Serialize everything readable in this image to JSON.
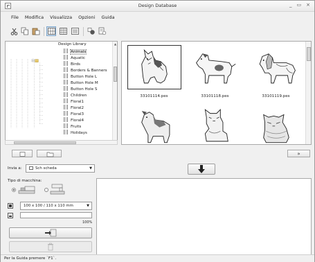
{
  "window": {
    "title": "Design Database",
    "controls": [
      "_",
      "▭",
      "×"
    ]
  },
  "menu": [
    "File",
    "Modifica",
    "Visualizza",
    "Opzioni",
    "Guida"
  ],
  "toolbar": {
    "icons": [
      "cut-icon",
      "copy-icon",
      "paste-icon",
      "large-thumbnails-icon",
      "medium-thumbnails-icon",
      "details-view-icon",
      "record-icon",
      "properties-icon"
    ]
  },
  "tree": {
    "root": "Design Library",
    "items": [
      "Animals",
      "Aquatic",
      "Birds",
      "Borders & Banners",
      "Button Hole L",
      "Button Hole M",
      "Button Hole S",
      "Children",
      "Floral1",
      "Floral2",
      "Floral3",
      "Floral4",
      "Fruits",
      "Holidays"
    ],
    "selected": "Animals"
  },
  "files": [
    {
      "name": "33101114.pes",
      "selected": true,
      "subject": "husky-puppy"
    },
    {
      "name": "33101118.pes",
      "selected": false,
      "subject": "spotted-dog"
    },
    {
      "name": "33101119.pes",
      "selected": false,
      "subject": "spaniel"
    },
    {
      "name": "",
      "selected": false,
      "subject": "terrier"
    },
    {
      "name": "",
      "selected": false,
      "subject": "cat"
    },
    {
      "name": "",
      "selected": false,
      "subject": "persian-cat"
    }
  ],
  "lower": {
    "send_label": "Invia a:",
    "send_value": "Sch scheda",
    "machine_label": "Tipo di macchina:",
    "hoop_value": "100 x 100 / 110 x 110 mm",
    "progress_percent": "100%",
    "progress_value": 1.0
  },
  "colors": {
    "accent": "#7aa3c9",
    "selection": "#dbe8f5"
  },
  "status": "Per la Guida premere `F1`."
}
